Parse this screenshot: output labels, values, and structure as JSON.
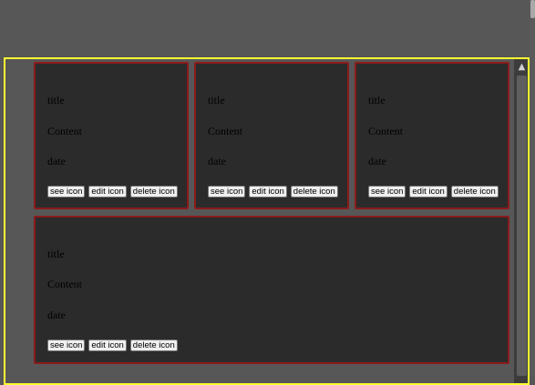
{
  "cards": [
    {
      "title": "title",
      "content": "Content",
      "date": "date",
      "see": "see icon",
      "edit": "edit icon",
      "delete": "delete icon"
    },
    {
      "title": "title",
      "content": "Content",
      "date": "date",
      "see": "see icon",
      "edit": "edit icon",
      "delete": "delete icon"
    },
    {
      "title": "title",
      "content": "Content",
      "date": "date",
      "see": "see icon",
      "edit": "edit icon",
      "delete": "delete icon"
    },
    {
      "title": "title",
      "content": "Content",
      "date": "date",
      "see": "see icon",
      "edit": "edit icon",
      "delete": "delete icon"
    }
  ],
  "scrollbar": {
    "up_arrow": "▲"
  },
  "colors": {
    "page_background": "#575757",
    "container_border": "#ffff33",
    "card_background": "#2b2b2b",
    "card_border": "#8b1a1a"
  }
}
